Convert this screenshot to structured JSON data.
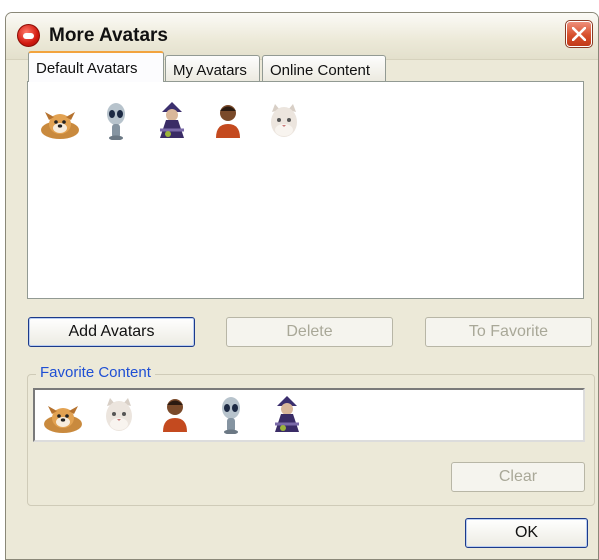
{
  "window": {
    "title": "More Avatars",
    "app_icon": "messenger-logo-icon",
    "close_icon": "close-icon"
  },
  "tabs": [
    {
      "label": "Default Avatars",
      "active": true
    },
    {
      "label": "My Avatars",
      "active": false
    },
    {
      "label": "Online Content",
      "active": false
    }
  ],
  "default_avatars": [
    "dog-avatar",
    "alien-avatar",
    "witch-avatar",
    "boy-avatar",
    "cat-avatar"
  ],
  "buttons": {
    "add_avatars": "Add Avatars",
    "delete": "Delete",
    "to_favorite": "To Favorite",
    "clear": "Clear",
    "ok": "OK"
  },
  "favorite": {
    "legend": "Favorite Content",
    "items": [
      "dog-avatar",
      "cat-avatar",
      "boy-avatar",
      "alien-avatar",
      "witch-avatar"
    ]
  },
  "colors": {
    "accent_focus": "#1c3a8a",
    "legend_text": "#1f4fd4",
    "close_button": "#d7502d",
    "active_tab_border": "#f2a33e"
  }
}
